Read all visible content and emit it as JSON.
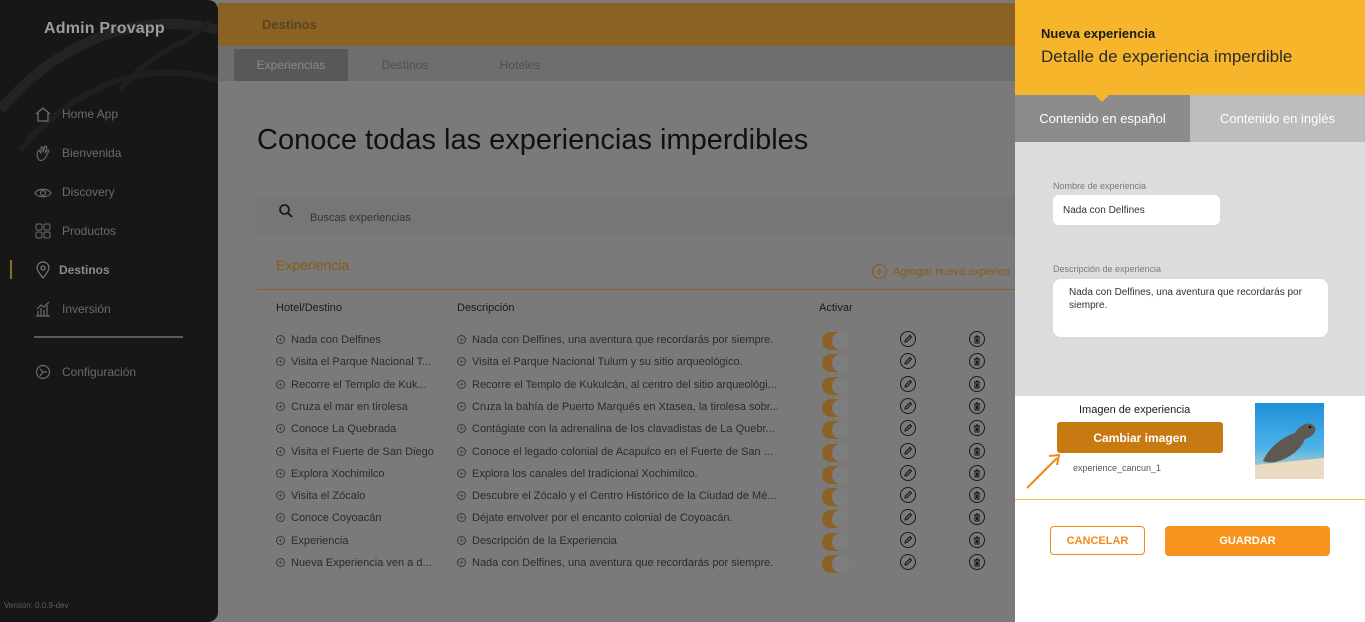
{
  "app": {
    "brand": "Admin Provapp",
    "version": "Versión: 0.0.9-dev"
  },
  "sidebar": {
    "items": [
      {
        "label": "Home App",
        "icon": "home-icon"
      },
      {
        "label": "Bienvenida",
        "icon": "hand-wave-icon"
      },
      {
        "label": "Discovery",
        "icon": "eye-icon"
      },
      {
        "label": "Productos",
        "icon": "grid-icon"
      },
      {
        "label": "Destinos",
        "icon": "location-pin-icon",
        "active": true
      },
      {
        "label": "Inversión",
        "icon": "chart-bars-icon"
      }
    ],
    "config": {
      "label": "Configuración",
      "icon": "gear-icon"
    }
  },
  "header": {
    "title": "Destinos"
  },
  "tabs": [
    {
      "label": "Experiencias",
      "active": true
    },
    {
      "label": "Destinos"
    },
    {
      "label": "Hoteles"
    }
  ],
  "main": {
    "title": "Conoce todas las experiencias imperdibles",
    "search_placeholder": "Buscas experiencias",
    "section_title": "Experiencia",
    "add_new": "Agregar nueva experien",
    "columns": {
      "hotel": "Hotel/Destino",
      "desc": "Descripción",
      "active": "Activar"
    },
    "rows": [
      {
        "hotel": "Nada con Delfines",
        "desc": "Nada con Delfines, una aventura que recordarás por siempre."
      },
      {
        "hotel": "Visita el Parque Nacional T...",
        "desc": "Visita el Parque Nacional Tulum y su sitio arqueológico."
      },
      {
        "hotel": "Recorre el Templo de Kuk...",
        "desc": "Recorre el Templo de Kukulcán, al centro del sitio arqueológi..."
      },
      {
        "hotel": "Cruza el mar en tirolesa",
        "desc": "Cruza la bahía de Puerto Marqués en Xtasea, la tirolesa sobr..."
      },
      {
        "hotel": "Conoce La Quebrada",
        "desc": "Contágiate con la adrenalina de los clavadistas de La Quebr..."
      },
      {
        "hotel": "Visita el Fuerte de San Diego",
        "desc": "Conoce el legado colonial de Acapulco en el Fuerte de San ..."
      },
      {
        "hotel": "Explora Xochimilco",
        "desc": "Explora los canales del tradicional Xochimilco."
      },
      {
        "hotel": "Visita el Zócalo",
        "desc": "Descubre el Zócalo y el Centro Histórico de la Ciudad de Mé..."
      },
      {
        "hotel": "Conoce Coyoacán",
        "desc": "Déjate envolver por el encanto colonial de Coyoacán."
      },
      {
        "hotel": "Experiencia",
        "desc": "Descripción de la Experiencia"
      },
      {
        "hotel": "Nueva Experiencia ven a d...",
        "desc": "Nada con Delfines, una aventura que recordarás por siempre."
      }
    ]
  },
  "panel": {
    "title": "Nueva experiencia",
    "subtitle": "Detalle de experiencia imperdible",
    "tab_es": "Contenido en español",
    "tab_en": "Contenido en inglés",
    "name_label": "Nombre de experiencia",
    "name_value": "Nada con Delfines",
    "desc_label": "Descripción de experiencia",
    "desc_value": "Nada con Delfines, una aventura que recordarás por siempre.",
    "image_label": "Imagen de experiencia",
    "change_image": "Cambiar imagen",
    "image_file": "experience_cancun_1",
    "cancel": "CANCELAR",
    "save": "GUARDAR"
  },
  "colors": {
    "accent": "#f7b52c",
    "button": "#c77a12",
    "save": "#f7941d"
  }
}
